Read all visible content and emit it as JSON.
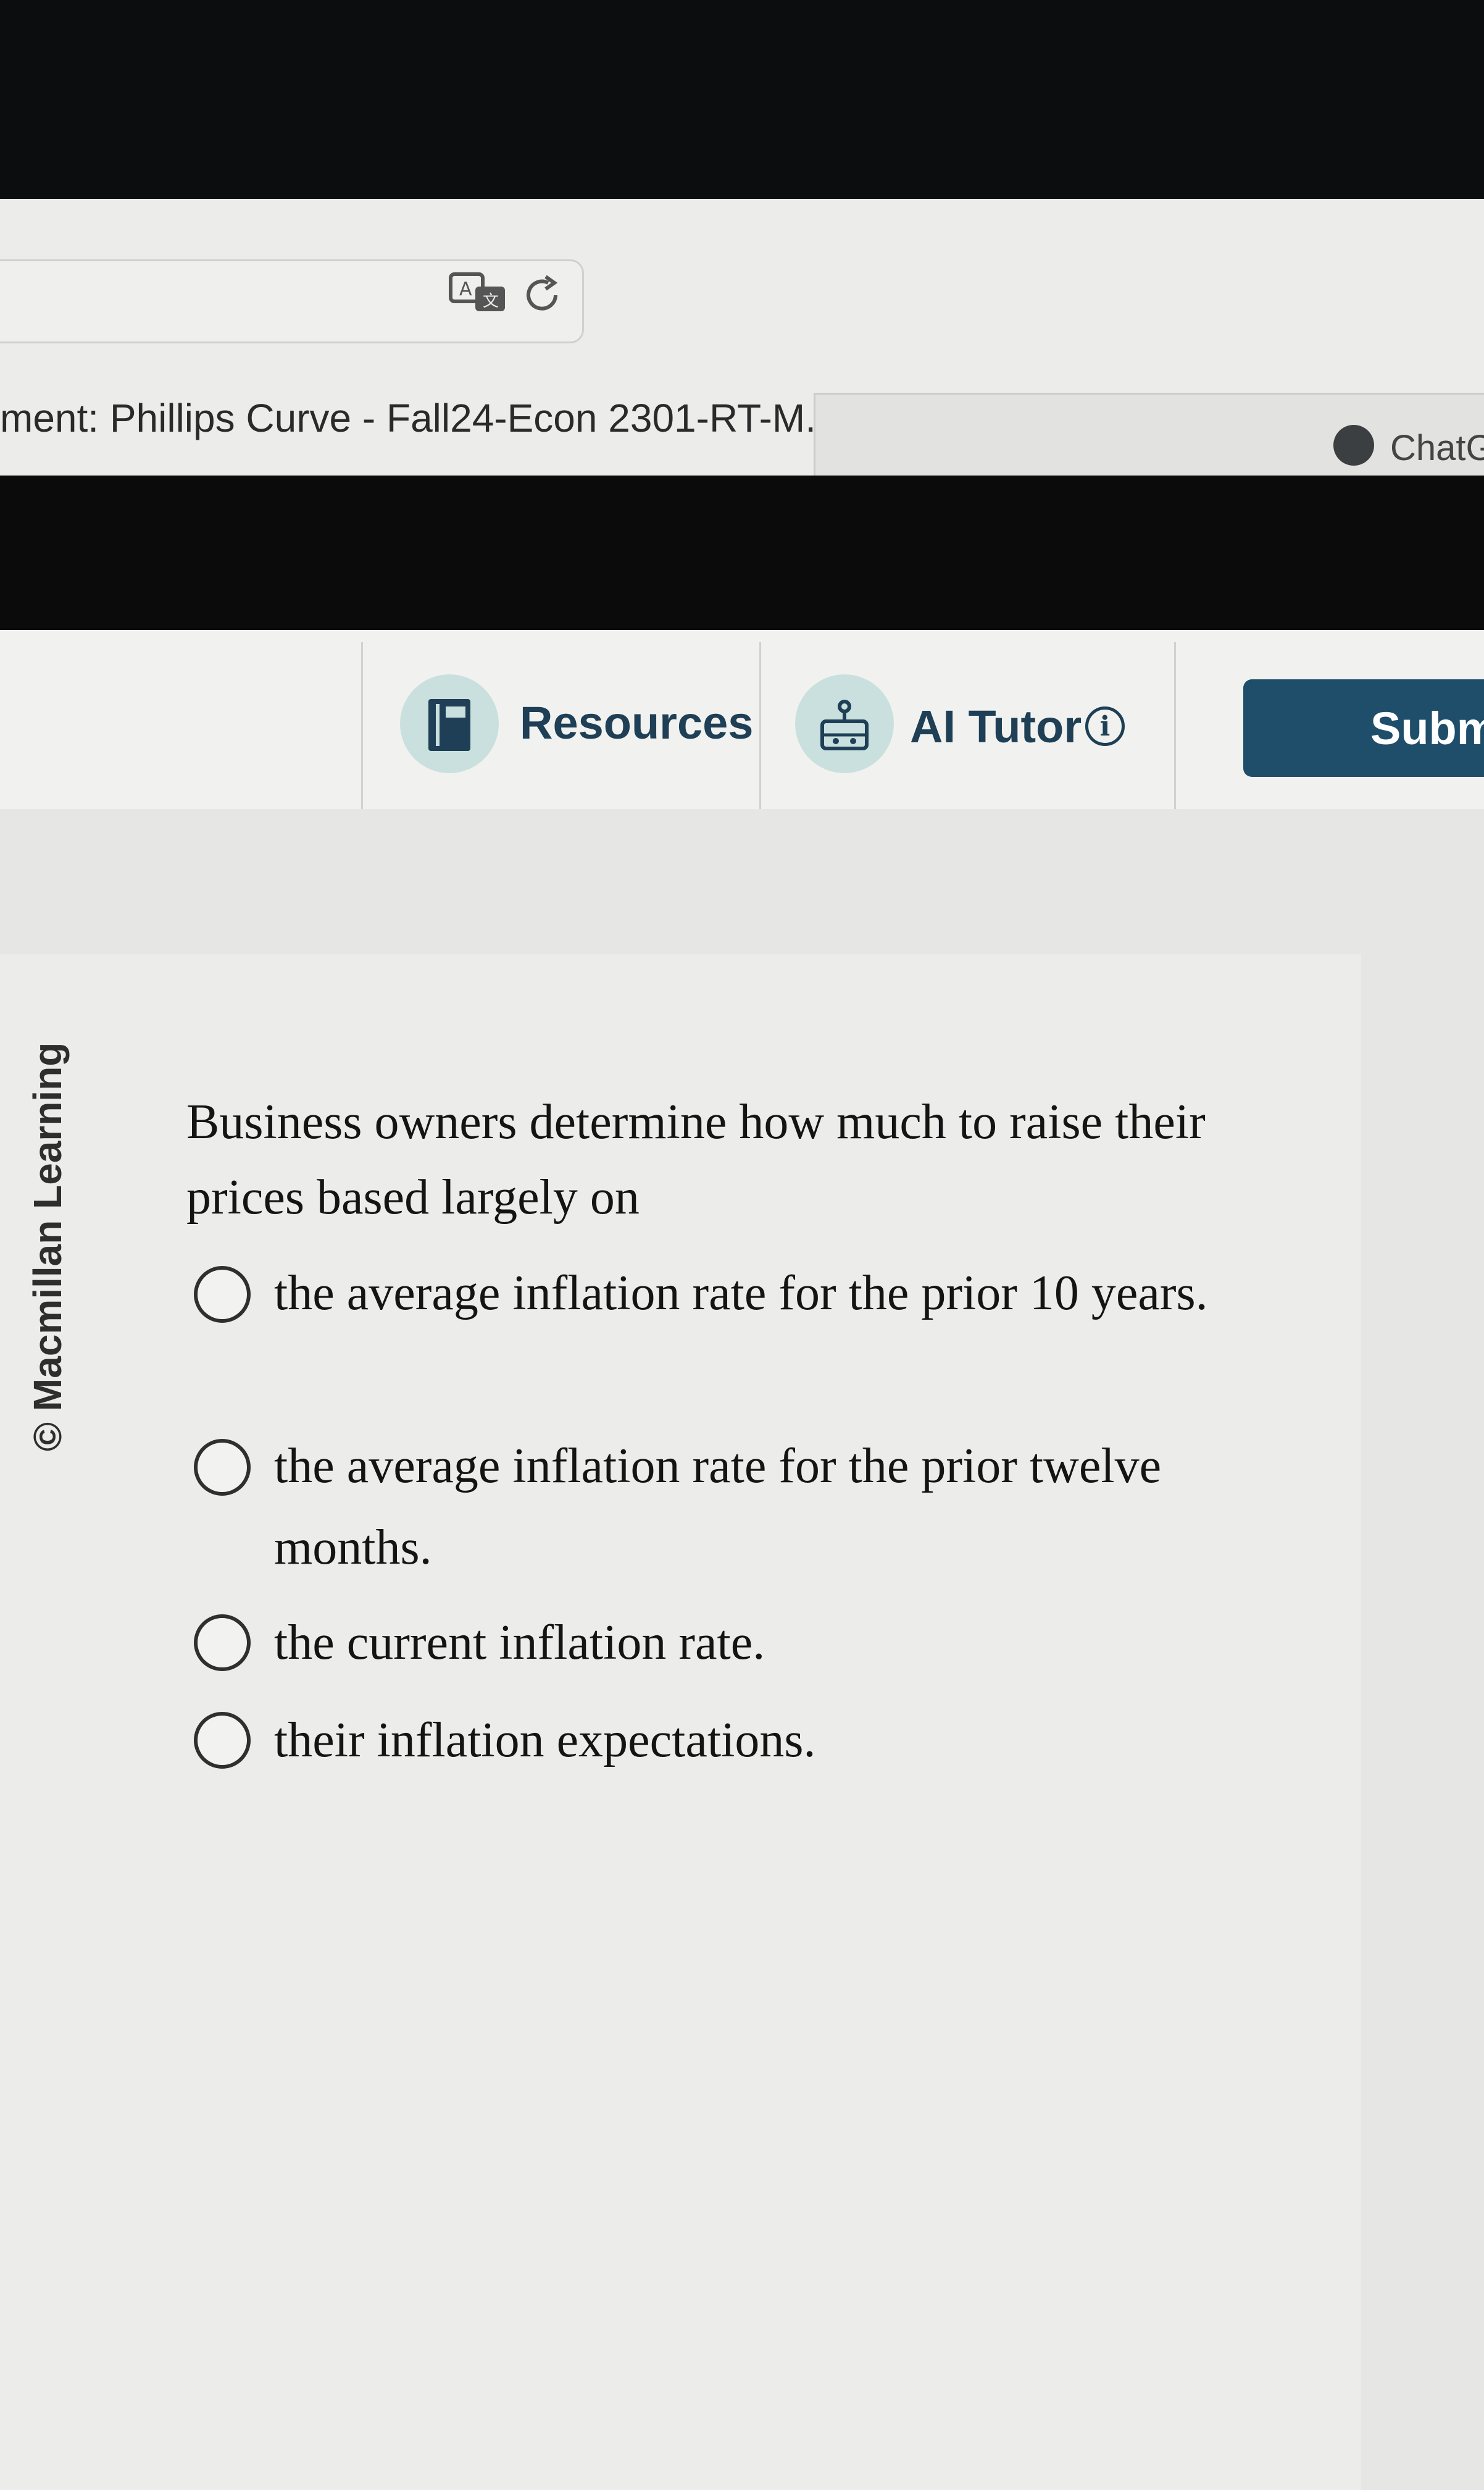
{
  "browser": {
    "tab_title": "ment: Phillips Curve - Fall24-Econ 2301-RT-M...",
    "extension_label": "ChatG"
  },
  "toolbar": {
    "resources_label": "Resources",
    "ai_tutor_label": "AI Tutor",
    "info_glyph": "i",
    "submit_label": "Submi"
  },
  "sidebar": {
    "copyright": "© Macmillan Learning"
  },
  "question": {
    "text": "Business owners determine how much to raise their prices based largely on",
    "options": [
      {
        "label": "the average inflation rate for the prior 10 years.",
        "selected": false
      },
      {
        "label": "the average inflation rate for the prior twelve months.",
        "selected": false
      },
      {
        "label": "the current inflation rate.",
        "selected": false
      },
      {
        "label": "their inflation expectations.",
        "selected": false
      }
    ]
  },
  "colors": {
    "accent": "#1f4e6b",
    "icon_bg": "#c9e0df",
    "page_bg": "#e7e8e6"
  },
  "icons": [
    "translate-icon",
    "reload-icon",
    "chatgpt-icon",
    "book-icon",
    "robot-icon",
    "info-icon",
    "radio-icon"
  ]
}
